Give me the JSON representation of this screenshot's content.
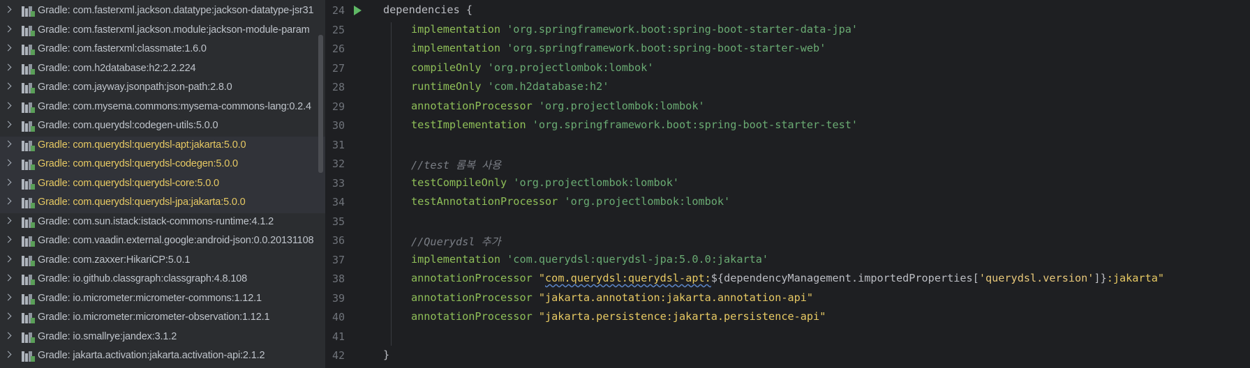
{
  "project_tree": {
    "items": [
      {
        "label": "Gradle: com.fasterxml.jackson.datatype:jackson-datatype-jsr31",
        "highlighted": false
      },
      {
        "label": "Gradle: com.fasterxml.jackson.module:jackson-module-param",
        "highlighted": false
      },
      {
        "label": "Gradle: com.fasterxml:classmate:1.6.0",
        "highlighted": false
      },
      {
        "label": "Gradle: com.h2database:h2:2.2.224",
        "highlighted": false
      },
      {
        "label": "Gradle: com.jayway.jsonpath:json-path:2.8.0",
        "highlighted": false
      },
      {
        "label": "Gradle: com.mysema.commons:mysema-commons-lang:0.2.4",
        "highlighted": false
      },
      {
        "label": "Gradle: com.querydsl:codegen-utils:5.0.0",
        "highlighted": false
      },
      {
        "label": "Gradle: com.querydsl:querydsl-apt:jakarta:5.0.0",
        "highlighted": true
      },
      {
        "label": "Gradle: com.querydsl:querydsl-codegen:5.0.0",
        "highlighted": true
      },
      {
        "label": "Gradle: com.querydsl:querydsl-core:5.0.0",
        "highlighted": true
      },
      {
        "label": "Gradle: com.querydsl:querydsl-jpa:jakarta:5.0.0",
        "highlighted": true
      },
      {
        "label": "Gradle: com.sun.istack:istack-commons-runtime:4.1.2",
        "highlighted": false
      },
      {
        "label": "Gradle: com.vaadin.external.google:android-json:0.0.20131108",
        "highlighted": false
      },
      {
        "label": "Gradle: com.zaxxer:HikariCP:5.0.1",
        "highlighted": false
      },
      {
        "label": "Gradle: io.github.classgraph:classgraph:4.8.108",
        "highlighted": false
      },
      {
        "label": "Gradle: io.micrometer:micrometer-commons:1.12.1",
        "highlighted": false
      },
      {
        "label": "Gradle: io.micrometer:micrometer-observation:1.12.1",
        "highlighted": false
      },
      {
        "label": "Gradle: io.smallrye:jandex:3.1.2",
        "highlighted": false
      },
      {
        "label": "Gradle: jakarta.activation:jakarta.activation-api:2.1.2",
        "highlighted": false
      }
    ]
  },
  "editor": {
    "line_numbers": [
      "24",
      "25",
      "26",
      "27",
      "28",
      "29",
      "30",
      "31",
      "32",
      "33",
      "34",
      "35",
      "36",
      "37",
      "38",
      "39",
      "40",
      "41",
      "42"
    ],
    "lines": {
      "l24": {
        "keyword": "dependencies",
        "brace": " {"
      },
      "l25": {
        "config": "implementation",
        "str": " 'org.springframework.boot:spring-boot-starter-data-jpa'"
      },
      "l26": {
        "config": "implementation",
        "str": " 'org.springframework.boot:spring-boot-starter-web'"
      },
      "l27": {
        "config": "compileOnly",
        "str": " 'org.projectlombok:lombok'"
      },
      "l28": {
        "config": "runtimeOnly",
        "str": " 'com.h2database:h2'"
      },
      "l29": {
        "config": "annotationProcessor",
        "str": " 'org.projectlombok:lombok'"
      },
      "l30": {
        "config": "testImplementation",
        "str": " 'org.springframework.boot:spring-boot-starter-test'"
      },
      "l32": {
        "comment": "//test 롬복 사용"
      },
      "l33": {
        "config": "testCompileOnly",
        "str": " 'org.projectlombok:lombok'"
      },
      "l34": {
        "config": "testAnnotationProcessor",
        "str": " 'org.projectlombok:lombok'"
      },
      "l36": {
        "comment": "//Querydsl 추가"
      },
      "l37": {
        "config": "implementation",
        "str": " 'com.querydsl:querydsl-jpa:5.0.0:jakarta'"
      },
      "l38": {
        "config": "annotationProcessor",
        "q_open": " \"",
        "gstr_a": "com.querydsl:querydsl-apt:",
        "dollar": "${",
        "expr": "dependencyManagement.importedProperties[",
        "key": "'querydsl.version'",
        "expr_close": "]}",
        "gstr_b": ":jakarta\""
      },
      "l39": {
        "config": "annotationProcessor",
        "gstr": " \"jakarta.annotation:jakarta.annotation-api\""
      },
      "l40": {
        "config": "annotationProcessor",
        "gstr": " \"jakarta.persistence:jakarta.persistence-api\""
      },
      "l42": {
        "brace": "}"
      }
    }
  }
}
